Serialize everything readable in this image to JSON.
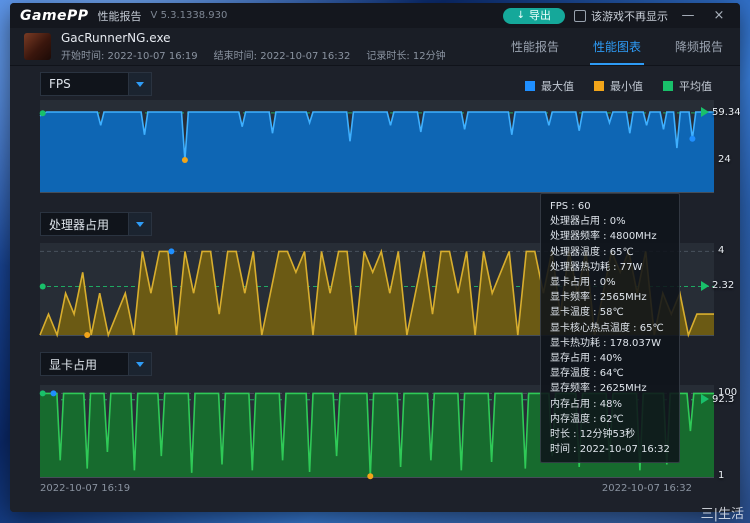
{
  "desktop": {
    "watermark": "三|生活"
  },
  "titlebar": {
    "logo": "GamePP",
    "title": "性能报告",
    "version": "V 5.3.1338.930",
    "export_label": "导出",
    "export_icon": "↓",
    "hide_game_label": "该游戏不再显示",
    "minimize_icon": "—",
    "close_icon": "×"
  },
  "header": {
    "process": "GacRunnerNG.exe",
    "start": "开始时间: 2022-10-07 16:19",
    "end": "结束时间: 2022-10-07 16:32",
    "duration": "记录时长: 12分钟",
    "tabs": [
      {
        "label": "性能报告"
      },
      {
        "label": "性能图表"
      },
      {
        "label": "降频报告"
      }
    ]
  },
  "legend": [
    {
      "label": "最大值",
      "color": "#1f8fff"
    },
    {
      "label": "最小值",
      "color": "#f2a51a"
    },
    {
      "label": "平均值",
      "color": "#19c06a"
    }
  ],
  "footer": {
    "time_start": "2022-10-07 16:19",
    "time_end": "2022-10-07 16:32"
  },
  "tooltip": {
    "lines": [
      "FPS : 60",
      "处理器占用 : 0%",
      "处理器频率 : 4800MHz",
      "处理器温度 : 65℃",
      "处理器热功耗 : 77W",
      "显卡占用 : 0%",
      "显卡频率 : 2565MHz",
      "显卡温度 : 58℃",
      "显卡核心热点温度 : 65℃",
      "显卡热功耗 : 178.037W",
      "显存占用 : 40%",
      "显存温度 : 64℃",
      "显存频率 : 2625MHz",
      "内存占用 : 48%",
      "内存温度 : 62℃",
      "时长 : 12分钟53秒",
      "时间 : 2022-10-07 16:32"
    ]
  },
  "chart_data": [
    {
      "name": "FPS",
      "type": "area",
      "line": "#3fb0ff",
      "fill": "#0e66b4",
      "vmin": 0,
      "vmax": 69,
      "avg": 59.34,
      "min": 24,
      "x_range": [
        "2022-10-07 16:19",
        "2022-10-07 16:32"
      ],
      "labels": [
        {
          "v": 59.34,
          "text": "59.34",
          "arrow": true
        },
        {
          "v": 24,
          "text": "24"
        }
      ],
      "markers": [
        {
          "x": 0.004,
          "v": 59,
          "c": "#19c06a"
        },
        {
          "x": 0.215,
          "v": 24,
          "c": "#f2a51a"
        },
        {
          "x": 0.968,
          "v": 40,
          "c": "#1f8fff"
        }
      ],
      "points": [
        [
          0,
          57
        ],
        [
          0.01,
          60
        ],
        [
          0.085,
          60
        ],
        [
          0.09,
          50
        ],
        [
          0.095,
          60
        ],
        [
          0.15,
          60
        ],
        [
          0.155,
          43
        ],
        [
          0.16,
          60
        ],
        [
          0.21,
          60
        ],
        [
          0.215,
          24
        ],
        [
          0.22,
          60
        ],
        [
          0.295,
          60
        ],
        [
          0.3,
          49
        ],
        [
          0.305,
          60
        ],
        [
          0.34,
          60
        ],
        [
          0.345,
          44
        ],
        [
          0.35,
          60
        ],
        [
          0.395,
          60
        ],
        [
          0.4,
          52
        ],
        [
          0.405,
          60
        ],
        [
          0.455,
          60
        ],
        [
          0.46,
          38
        ],
        [
          0.465,
          60
        ],
        [
          0.515,
          60
        ],
        [
          0.52,
          50
        ],
        [
          0.525,
          60
        ],
        [
          0.56,
          60
        ],
        [
          0.565,
          45
        ],
        [
          0.57,
          60
        ],
        [
          0.625,
          60
        ],
        [
          0.63,
          47
        ],
        [
          0.635,
          60
        ],
        [
          0.695,
          60
        ],
        [
          0.7,
          43
        ],
        [
          0.705,
          60
        ],
        [
          0.75,
          60
        ],
        [
          0.755,
          50
        ],
        [
          0.76,
          60
        ],
        [
          0.795,
          60
        ],
        [
          0.8,
          46
        ],
        [
          0.805,
          60
        ],
        [
          0.84,
          60
        ],
        [
          0.845,
          52
        ],
        [
          0.85,
          60
        ],
        [
          0.87,
          60
        ],
        [
          0.875,
          44
        ],
        [
          0.88,
          60
        ],
        [
          0.895,
          60
        ],
        [
          0.9,
          50
        ],
        [
          0.905,
          60
        ],
        [
          0.92,
          60
        ],
        [
          0.925,
          47
        ],
        [
          0.93,
          60
        ],
        [
          0.94,
          60
        ],
        [
          0.945,
          33
        ],
        [
          0.95,
          60
        ],
        [
          0.963,
          60
        ],
        [
          0.968,
          40
        ],
        [
          0.973,
          60
        ],
        [
          1,
          60
        ]
      ]
    },
    {
      "name": "处理器占用",
      "type": "area",
      "line": "#d8ae2e",
      "fill": "#6b5a14",
      "vmin": 0,
      "vmax": 4.4,
      "avg": 2.32,
      "max": 4,
      "x_range": [
        "2022-10-07 16:19",
        "2022-10-07 16:32"
      ],
      "labels": [
        {
          "v": 4,
          "text": "4"
        },
        {
          "v": 2.32,
          "text": "2.32",
          "arrow": true
        }
      ],
      "markers": [
        {
          "x": 0.004,
          "v": 2.32,
          "c": "#19c06a"
        },
        {
          "x": 0.07,
          "v": 0,
          "c": "#f2a51a"
        },
        {
          "x": 0.195,
          "v": 4,
          "c": "#1f8fff"
        }
      ],
      "values": [
        0,
        1,
        0,
        2,
        1,
        3,
        0,
        2,
        0,
        1,
        2,
        0,
        4,
        2,
        4,
        4,
        0,
        4,
        2,
        4,
        4,
        1,
        4,
        4,
        2,
        4,
        0,
        2,
        4,
        4,
        3,
        4,
        0,
        4,
        2,
        4,
        4,
        0,
        4,
        3,
        4,
        2,
        4,
        0,
        2,
        4,
        1,
        4,
        4,
        2,
        4,
        0,
        4,
        2,
        3,
        4,
        0,
        4,
        4,
        2,
        4,
        1,
        4,
        2,
        4,
        0,
        2,
        4,
        3,
        4,
        2,
        4,
        0,
        2,
        1,
        2,
        0,
        1,
        1,
        1
      ]
    },
    {
      "name": "显卡占用",
      "type": "area",
      "line": "#2fca57",
      "fill": "#176b2e",
      "vmin": 0,
      "vmax": 110,
      "avg": 92.3,
      "max": 100,
      "min": 1,
      "x_range": [
        "2022-10-07 16:19",
        "2022-10-07 16:32"
      ],
      "labels": [
        {
          "v": 100,
          "text": "100"
        },
        {
          "v": 92.3,
          "text": "92.3",
          "arrow": true
        },
        {
          "v": 1,
          "text": "1"
        }
      ],
      "markers": [
        {
          "x": 0.004,
          "v": 100,
          "c": "#19c06a"
        },
        {
          "x": 0.02,
          "v": 100,
          "c": "#1f8fff"
        },
        {
          "x": 0.49,
          "v": 1,
          "c": "#f2a51a"
        }
      ],
      "points": [
        [
          0,
          100
        ],
        [
          0.025,
          100
        ],
        [
          0.03,
          20
        ],
        [
          0.035,
          100
        ],
        [
          0.065,
          100
        ],
        [
          0.07,
          10
        ],
        [
          0.075,
          100
        ],
        [
          0.095,
          100
        ],
        [
          0.1,
          30
        ],
        [
          0.105,
          100
        ],
        [
          0.135,
          100
        ],
        [
          0.14,
          8
        ],
        [
          0.145,
          100
        ],
        [
          0.175,
          100
        ],
        [
          0.18,
          25
        ],
        [
          0.185,
          100
        ],
        [
          0.22,
          100
        ],
        [
          0.225,
          5
        ],
        [
          0.23,
          100
        ],
        [
          0.265,
          100
        ],
        [
          0.27,
          15
        ],
        [
          0.275,
          100
        ],
        [
          0.31,
          100
        ],
        [
          0.315,
          8
        ],
        [
          0.32,
          100
        ],
        [
          0.355,
          100
        ],
        [
          0.36,
          20
        ],
        [
          0.365,
          100
        ],
        [
          0.395,
          100
        ],
        [
          0.4,
          6
        ],
        [
          0.405,
          100
        ],
        [
          0.435,
          100
        ],
        [
          0.44,
          25
        ],
        [
          0.445,
          100
        ],
        [
          0.485,
          100
        ],
        [
          0.49,
          1
        ],
        [
          0.495,
          100
        ],
        [
          0.53,
          100
        ],
        [
          0.535,
          12
        ],
        [
          0.54,
          100
        ],
        [
          0.575,
          100
        ],
        [
          0.58,
          20
        ],
        [
          0.585,
          100
        ],
        [
          0.62,
          100
        ],
        [
          0.625,
          8
        ],
        [
          0.63,
          100
        ],
        [
          0.665,
          100
        ],
        [
          0.67,
          18
        ],
        [
          0.675,
          100
        ],
        [
          0.715,
          100
        ],
        [
          0.72,
          10
        ],
        [
          0.725,
          100
        ],
        [
          0.755,
          100
        ],
        [
          0.76,
          25
        ],
        [
          0.765,
          100
        ],
        [
          0.795,
          100
        ],
        [
          0.8,
          12
        ],
        [
          0.805,
          100
        ],
        [
          0.84,
          100
        ],
        [
          0.845,
          20
        ],
        [
          0.85,
          100
        ],
        [
          0.885,
          100
        ],
        [
          0.89,
          8
        ],
        [
          0.895,
          100
        ],
        [
          0.925,
          100
        ],
        [
          0.93,
          15
        ],
        [
          0.935,
          100
        ],
        [
          0.96,
          100
        ],
        [
          0.965,
          55
        ],
        [
          0.97,
          100
        ],
        [
          1,
          100
        ]
      ]
    }
  ]
}
